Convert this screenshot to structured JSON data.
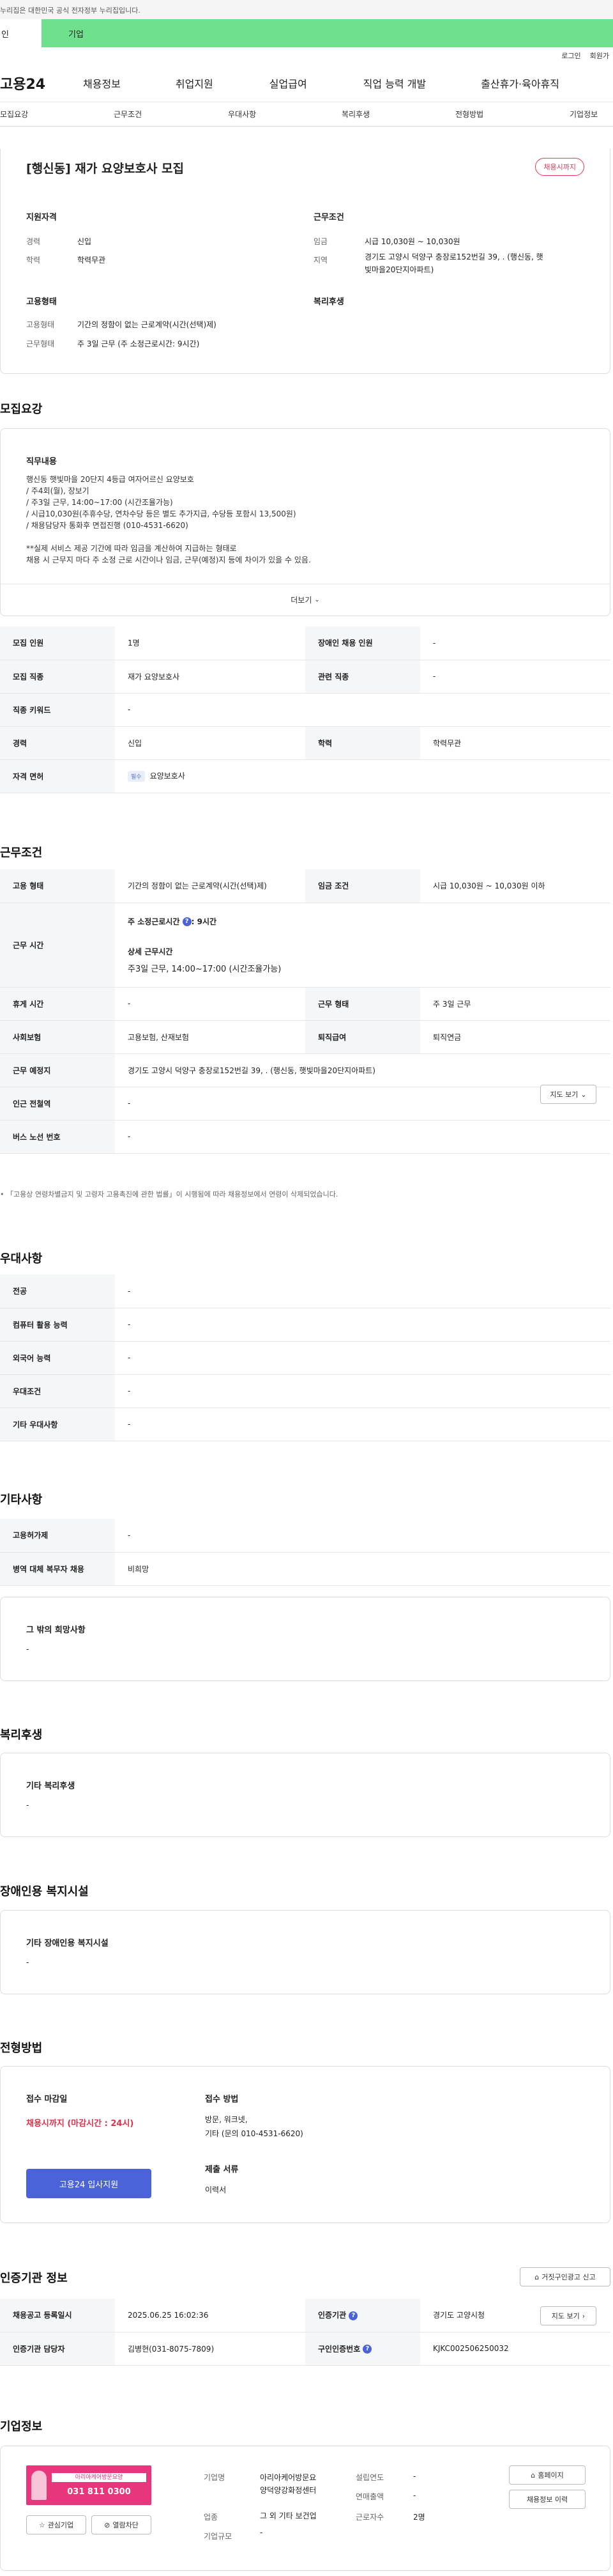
{
  "gov_notice": "누리집은 대한민국 공식 전자정부 누리집입니다.",
  "member_tabs": {
    "person": "인",
    "enterprise": "기업"
  },
  "util": {
    "login": "로그인",
    "join": "회원가"
  },
  "gnb": {
    "logo": "고용24",
    "items": [
      "채용정보",
      "취업지원",
      "실업급여",
      "직업 능력 개발",
      "출산휴가·육아휴직"
    ]
  },
  "subnav": [
    "모집요강",
    "근무조건",
    "우대사항",
    "복리후생",
    "전형방법",
    "기업정보"
  ],
  "job": {
    "title": "[행신동] 재가 요양보호사 모집",
    "status_badge": "채용시까지",
    "summary": {
      "qual_title": "지원자격",
      "cond_title": "근무조건",
      "emp_title": "고용형태",
      "welfare_title": "복리후생",
      "career_lbl": "경력",
      "career": "신입",
      "edu_lbl": "학력",
      "edu": "학력무관",
      "wage_lbl": "임금",
      "wage": "시급 10,030원 ~ 10,030원",
      "loc_lbl": "지역",
      "loc1": "경기도 고양시 덕양구 충장로152번길 39, . (행신동, 햇",
      "loc2": "빛마을20단지아파트)",
      "emptype_lbl": "고용형태",
      "emptype": "기간의 정함이 없는 근로계약(시간(선택)제)",
      "workform_lbl": "근무형태",
      "workform": "주 3일 근무 (주 소정근로시간: 9시간)"
    }
  },
  "recruit": {
    "section": "모집요강",
    "duty_title": "직무내용",
    "duty_lines": [
      "행신동 햇빛마을 20단지 4등급 여자어르신 요양보호",
      "/ 주4회(월), 장보기",
      "/ 주3일 근무,  14:00~17:00 (시간조율가능)",
      "/ 시급10,030원(주휴수당, 연차수당 등은 별도 추가지급, 수당등 포함시 13,500원)",
      "/ 채용담당자 통화후 면접진행 (010-4531-6620)",
      "",
      "**실제 서비스 제공 기간에 따라 임금을 계산하여 지급하는 형태로",
      "채용 시 근무지 마다 주 소정 근로 시간이나 임금, 근무(예정)지 등에 차이가 있을 수 있음."
    ],
    "more": "더보기",
    "rows": {
      "headcount_lbl": "모집 인원",
      "headcount": "1명",
      "disabled_lbl": "장애인 채용 인원",
      "disabled": "-",
      "job_lbl": "모집 직종",
      "job": "재가 요양보호사",
      "related_lbl": "관련 직종",
      "related": "-",
      "keyword_lbl": "직종 키워드",
      "keyword": "-",
      "career_lbl": "경력",
      "career": "신입",
      "edu_lbl": "학력",
      "edu": "학력무관",
      "license_lbl": "자격 면허",
      "license_badge": "필수",
      "license": "요양보호사"
    }
  },
  "conditions": {
    "section": "근무조건",
    "emptype_lbl": "고용 형태",
    "emptype": "기간의 정함이 없는 근로계약(시간(선택)제)",
    "wage_lbl": "임금 조건",
    "wage": "시급 10,030원 ~ 10,030원 이하",
    "worktime_lbl": "근무 시간",
    "weekly_lbl": "주 소정근로시간",
    "weekly": ": 9시간",
    "detail_lbl": "상세 근무시간",
    "detail": "주3일 근무,  14:00~17:00 (시간조율가능)",
    "rest_lbl": "휴게 시간",
    "rest": "-",
    "workform_lbl": "근무 형태",
    "workform": "주 3일 근무",
    "insurance_lbl": "사회보험",
    "insurance": "고용보험, 산재보험",
    "retire_lbl": "퇴직급여",
    "retire": "퇴직연금",
    "place_lbl": "근무 예정지",
    "place": "경기도 고양시 덕양구 충장로152번길 39, . (행신동, 햇빛마을20단지아파트)",
    "map_btn": "지도 보기",
    "subway_lbl": "인근 전철역",
    "subway": "-",
    "bus_lbl": "버스 노선 번호",
    "bus": "-",
    "note": "「고용상 연령차별금지 및 고령자 고용촉진에 관한 법률」이 시행됨에 따라 채용정보에서 연령이 삭제되었습니다."
  },
  "preference": {
    "section": "우대사항",
    "rows": [
      {
        "lbl": "전공",
        "val": "-"
      },
      {
        "lbl": "컴퓨터 활용 능력",
        "val": "-"
      },
      {
        "lbl": "외국어 능력",
        "val": "-"
      },
      {
        "lbl": "우대조건",
        "val": "-"
      },
      {
        "lbl": "기타 우대사항",
        "val": "-"
      }
    ]
  },
  "etc": {
    "section": "기타사항",
    "rows": [
      {
        "lbl": "고용허가제",
        "val": "-"
      },
      {
        "lbl": "병역 대체 복무자 채용",
        "val": "비희망"
      }
    ],
    "wish_title": "그 밖의 희망사항",
    "wish": "-"
  },
  "welfare": {
    "section": "복리후생",
    "title": "기타 복리후생",
    "val": "-"
  },
  "facility": {
    "section": "장애인용 복지시설",
    "title": "기타 장애인용 복지시설",
    "val": "-"
  },
  "process": {
    "section": "전형방법",
    "deadline_lbl": "접수 마감일",
    "deadline": "채용시까지 (마감시간 : 24시)",
    "method_lbl": "접수 방법",
    "method1": "방문, 워크넷,",
    "method2": "기타 (문의 010-4531-6620)",
    "apply_btn": "고용24 입사지원",
    "docs_lbl": "제출 서류",
    "docs": "이력서"
  },
  "agency": {
    "section": "인증기관 정보",
    "report_btn": "거짓구인광고 신고",
    "reg_lbl": "채용공고 등록일시",
    "reg": "2025.06.25 16:02:36",
    "org_lbl": "인증기관",
    "org": "경기도 고양시청",
    "map_btn": "지도 보기",
    "mgr_lbl": "인증기관 담당자",
    "mgr": "김병현(031-8075-7809)",
    "cert_lbl": "구인인증번호",
    "cert": "KJKC002506250032"
  },
  "company": {
    "section": "기업정보",
    "logo_text": "아리아케어방문요양",
    "logo_phone": "031 811 0300",
    "interest_btn": "관심기업",
    "block_btn": "열람차단",
    "name_lbl": "기업명",
    "name1": "아리아케어방문요",
    "name2": "양덕양강화정센터",
    "industry_lbl": "업종",
    "industry": "그 외 기타 보건업",
    "scale_lbl": "기업규모",
    "scale": "-",
    "founded_lbl": "설립연도",
    "founded": "-",
    "sales_lbl": "연매출액",
    "sales": "-",
    "staff_lbl": "근로자수",
    "staff": "2명",
    "home_btn": "홈페이지",
    "more_btn": "채용정보 이력"
  }
}
